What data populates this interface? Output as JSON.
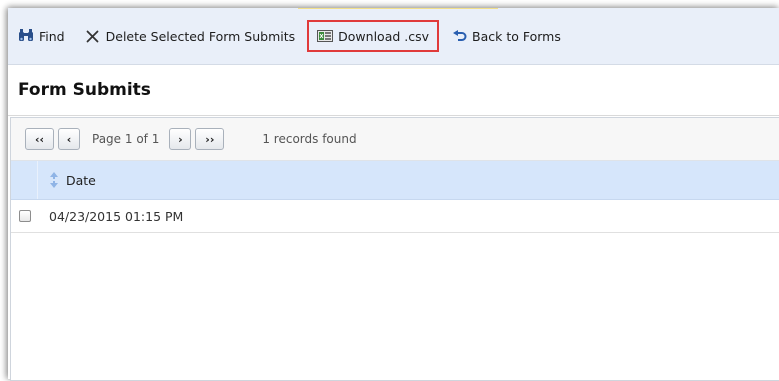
{
  "toolbar": {
    "find_label": "Find",
    "delete_label": "Delete Selected Form Submits",
    "download_label": "Download .csv",
    "back_label": "Back to Forms",
    "highlight_color": "#e03a3a"
  },
  "page_title": "Form Submits",
  "pager": {
    "first": "‹‹",
    "prev": "‹",
    "page_info": "Page 1 of 1",
    "next": "›",
    "last": "››",
    "records": "1 records found"
  },
  "table": {
    "columns": [
      "Date"
    ],
    "rows": [
      {
        "date": "04/23/2015 01:15 PM",
        "checked": false
      }
    ]
  },
  "icons": {
    "find": "binoculars-icon",
    "delete": "x-icon",
    "download": "csv-file-icon",
    "back": "undo-arrow-icon",
    "sort": "sort-arrows-icon"
  }
}
